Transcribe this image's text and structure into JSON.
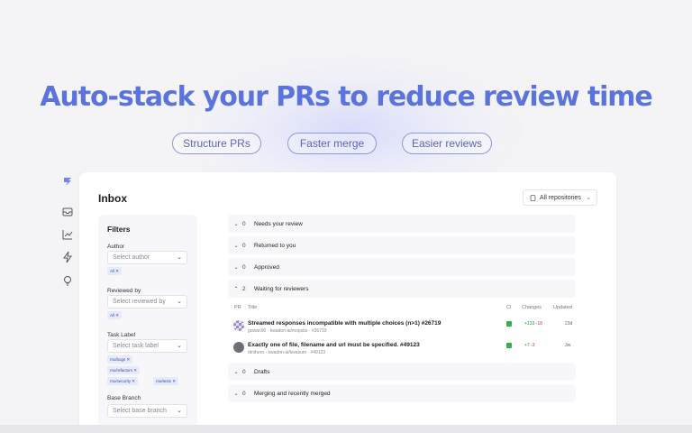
{
  "hero": {
    "title": "Auto-stack your PRs to reduce review time",
    "pills": [
      "Structure PRs",
      "Faster merge",
      "Easier reviews"
    ]
  },
  "colors": {
    "accent": "#5b74dd",
    "ci_pass": "#30b34b",
    "additions": "#1f9a3a",
    "deletions": "#c83b3b"
  },
  "sidebar": {
    "icons": [
      "logo-icon",
      "inbox-icon",
      "chart-icon",
      "lightning-icon",
      "lightbulb-icon"
    ]
  },
  "inbox": {
    "title": "Inbox",
    "repo_selector": "All repositories"
  },
  "filters": {
    "title": "Filters",
    "author": {
      "label": "Author",
      "placeholder": "Select author",
      "chips": [
        "All"
      ]
    },
    "reviewed_by": {
      "label": "Reviewed by",
      "placeholder": "Select reviewed by",
      "chips": [
        "All"
      ]
    },
    "task_label": {
      "label": "Task Label",
      "placeholder": "Select task label",
      "chips": [
        "rnx/bugs",
        "rnx/refactors",
        "rnx/security",
        "rnx/tests"
      ]
    },
    "base_branch": {
      "label": "Base Branch",
      "placeholder": "Select base branch"
    }
  },
  "sections": [
    {
      "count": "0",
      "name": "Needs your review",
      "expanded": false
    },
    {
      "count": "0",
      "name": "Returned to you",
      "expanded": false
    },
    {
      "count": "0",
      "name": "Approved",
      "expanded": false
    },
    {
      "count": "2",
      "name": "Waiting for reviewers",
      "expanded": true
    },
    {
      "count": "0",
      "name": "Drafts",
      "expanded": false
    },
    {
      "count": "0",
      "name": "Merging and recently merged",
      "expanded": false
    }
  ],
  "table": {
    "headers": {
      "pr": "PR",
      "title": "Title",
      "ci": "CI",
      "changes": "Changes",
      "updated": "Updated"
    },
    "rows": [
      {
        "title": "Streamed responses incompatible with multiple choices (n>1) #26719",
        "subtitle": "gowan90 · kwadon-ai/mopsbs · #26719",
        "additions": "+133",
        "deletions": "-18",
        "updated": "23d"
      },
      {
        "title": "Exactly one of file, filename and url must be specified. #49123",
        "subtitle": "dmihero · kwadon-ai/kwasum · #49123",
        "additions": "+7",
        "deletions": "-3",
        "updated": "3w"
      }
    ]
  }
}
